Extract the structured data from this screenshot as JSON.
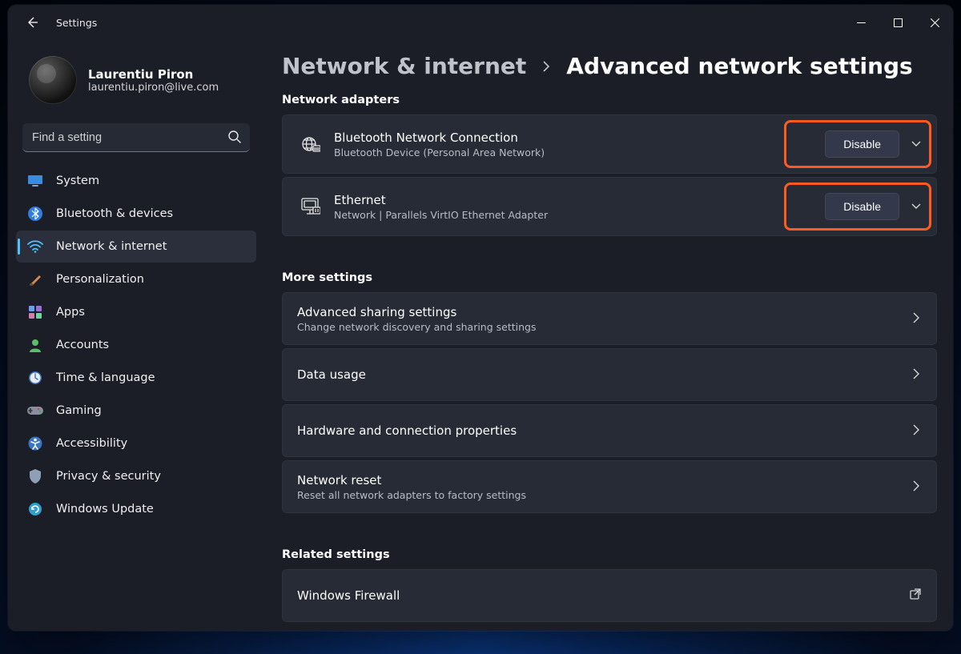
{
  "window": {
    "app_title": "Settings"
  },
  "profile": {
    "name": "Laurentiu Piron",
    "email": "laurentiu.piron@live.com"
  },
  "search": {
    "placeholder": "Find a setting"
  },
  "nav": {
    "items": [
      {
        "label": "System"
      },
      {
        "label": "Bluetooth & devices"
      },
      {
        "label": "Network & internet"
      },
      {
        "label": "Personalization"
      },
      {
        "label": "Apps"
      },
      {
        "label": "Accounts"
      },
      {
        "label": "Time & language"
      },
      {
        "label": "Gaming"
      },
      {
        "label": "Accessibility"
      },
      {
        "label": "Privacy & security"
      },
      {
        "label": "Windows Update"
      }
    ],
    "active_index": 2
  },
  "breadcrumb": {
    "parent": "Network & internet",
    "current": "Advanced network settings"
  },
  "sections": {
    "adapters_label": "Network adapters",
    "more_label": "More settings",
    "related_label": "Related settings"
  },
  "adapters": [
    {
      "title": "Bluetooth Network Connection",
      "sub": "Bluetooth Device (Personal Area Network)",
      "action": "Disable"
    },
    {
      "title": "Ethernet",
      "sub": "Network | Parallels VirtIO Ethernet Adapter",
      "action": "Disable"
    }
  ],
  "more": [
    {
      "title": "Advanced sharing settings",
      "sub": "Change network discovery and sharing settings"
    },
    {
      "title": "Data usage",
      "sub": ""
    },
    {
      "title": "Hardware and connection properties",
      "sub": ""
    },
    {
      "title": "Network reset",
      "sub": "Reset all network adapters to factory settings"
    }
  ],
  "related": [
    {
      "title": "Windows Firewall"
    }
  ]
}
